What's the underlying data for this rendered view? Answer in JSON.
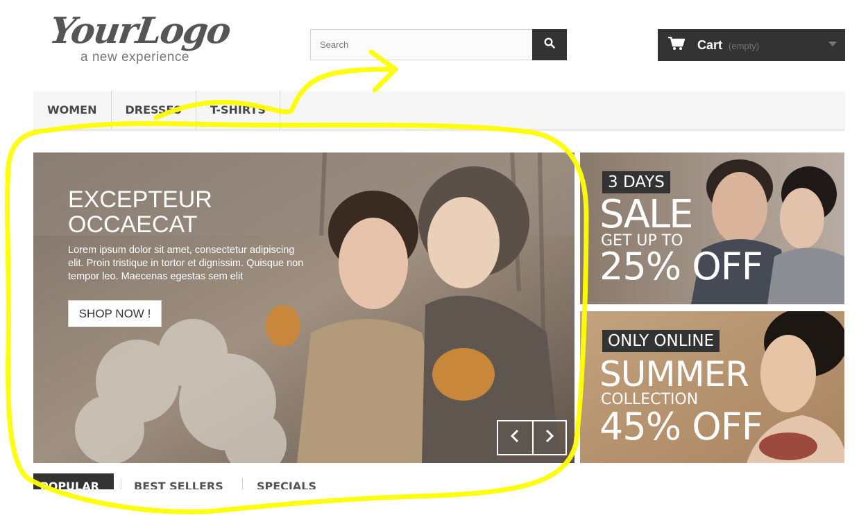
{
  "logo": {
    "main": "YourLogo",
    "tagline": "a new experience"
  },
  "search": {
    "placeholder": "Search",
    "button_icon": "search-icon"
  },
  "cart": {
    "label": "Cart",
    "status": "(empty)",
    "icon": "cart-icon"
  },
  "nav": {
    "items": [
      {
        "label": "WOMEN"
      },
      {
        "label": "DRESSES"
      },
      {
        "label": "T-SHIRTS"
      }
    ]
  },
  "slider": {
    "title": "EXCEPTEUR OCCAECAT",
    "text": "Lorem ipsum dolor sit amet, consectetur adipiscing elit. Proin tristique in tortor et dignissim. Quisque non tempor leo. Maecenas egestas sem elit",
    "button": "SHOP NOW !",
    "prev_icon": "chevron-left-icon",
    "next_icon": "chevron-right-icon"
  },
  "promo1": {
    "badge": "3 DAYS",
    "headline": "SALE",
    "sub": "GET UP TO",
    "offer": "25% OFF"
  },
  "promo2": {
    "badge": "ONLY ONLINE",
    "headline": "SUMMER",
    "sub": "COLLECTION",
    "offer": "45% OFF"
  },
  "tabs": [
    {
      "label": "POPULAR"
    },
    {
      "label": "BEST SELLERS"
    },
    {
      "label": "SPECIALS"
    }
  ],
  "colors": {
    "dark": "#333333",
    "annotation": "#ffff00",
    "nav_bg": "#f6f6f6"
  }
}
